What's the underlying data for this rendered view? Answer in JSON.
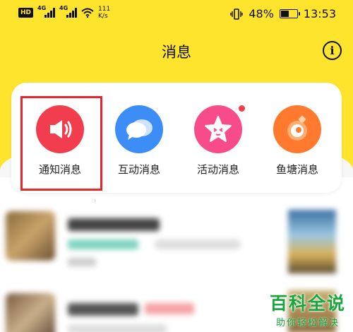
{
  "status_bar": {
    "hd": "HD",
    "sig1_label": "4G",
    "sig2_label": "4G",
    "net_speed_value": "111",
    "net_speed_unit": "K/s",
    "battery_percent": "48%",
    "battery_level": 0.48,
    "time": "13:53"
  },
  "header": {
    "title": "消息",
    "info_icon": "info-icon",
    "info_glyph": "i"
  },
  "categories": [
    {
      "label": "通知消息",
      "icon": "speaker-icon",
      "color": "#F23D4F"
    },
    {
      "label": "互动消息",
      "icon": "chat-bubbles-icon",
      "color": "#3C8DF5"
    },
    {
      "label": "活动消息",
      "icon": "star-face-icon",
      "color": "#F84C8A",
      "badge": true
    },
    {
      "label": "鱼塘消息",
      "icon": "fish-pond-icon",
      "color": "#FF7A2E"
    }
  ],
  "annotation": {
    "highlight_color": "#E5262B"
  },
  "watermark": {
    "main": "百科全说",
    "sub": "助你轻松解决"
  }
}
